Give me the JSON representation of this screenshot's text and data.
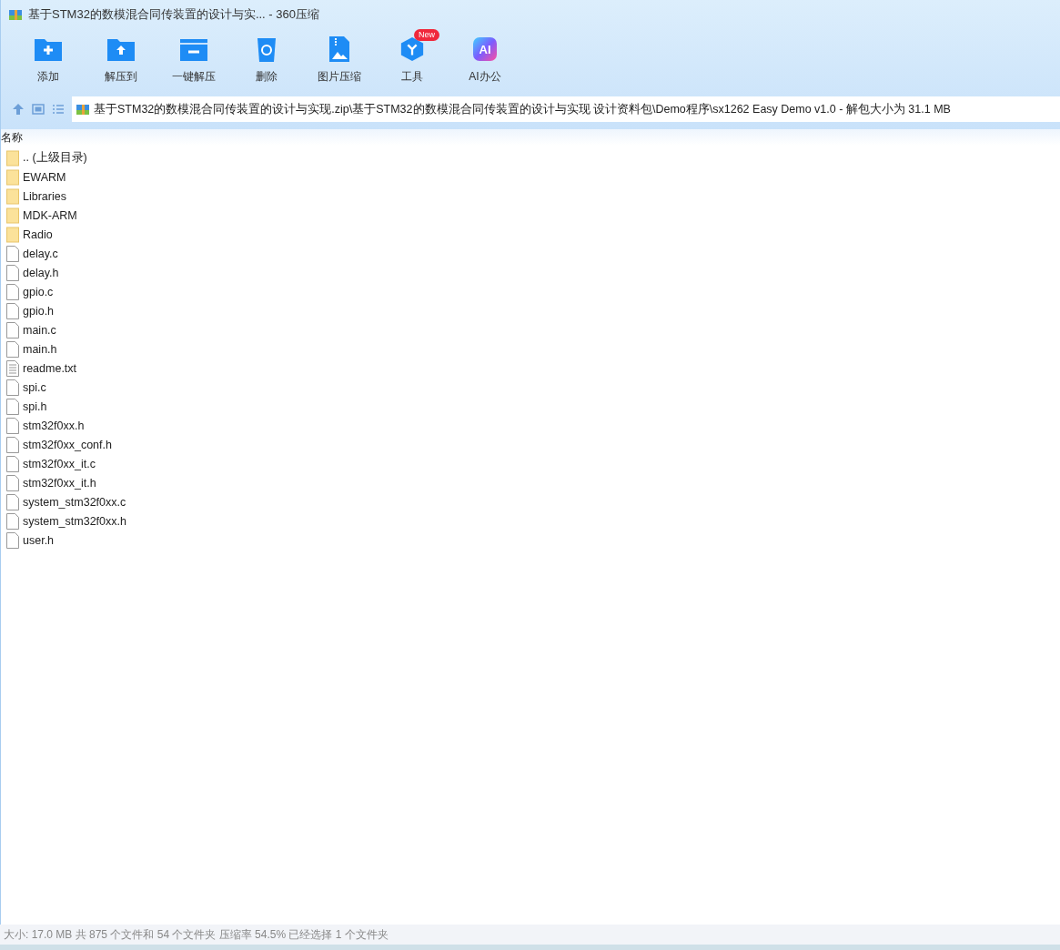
{
  "window": {
    "title": "基于STM32的数模混合同传装置的设计与实... - 360压缩"
  },
  "toolbar": [
    {
      "label": "添加",
      "kind": "add"
    },
    {
      "label": "解压到",
      "kind": "extract"
    },
    {
      "label": "一键解压",
      "kind": "oneclick"
    },
    {
      "label": "删除",
      "kind": "delete"
    },
    {
      "label": "图片压缩",
      "kind": "image"
    },
    {
      "label": "工具",
      "kind": "tools",
      "badge": "New"
    },
    {
      "label": "AI办公",
      "kind": "ai",
      "icon_text": "AI"
    }
  ],
  "address": {
    "path": "基于STM32的数模混合同传装置的设计与实现.zip\\基于STM32的数模混合同传装置的设计与实现 设计资料包\\Demo程序\\sx1262 Easy Demo v1.0 - 解包大小为 31.1 MB"
  },
  "table": {
    "columns": [
      "名称"
    ],
    "rows": [
      {
        "name": ".. (上级目录)",
        "kind": "folder"
      },
      {
        "name": "EWARM",
        "kind": "folder"
      },
      {
        "name": "Libraries",
        "kind": "folder"
      },
      {
        "name": "MDK-ARM",
        "kind": "folder"
      },
      {
        "name": "Radio",
        "kind": "folder"
      },
      {
        "name": "delay.c",
        "kind": "file"
      },
      {
        "name": "delay.h",
        "kind": "file"
      },
      {
        "name": "gpio.c",
        "kind": "file"
      },
      {
        "name": "gpio.h",
        "kind": "file"
      },
      {
        "name": "main.c",
        "kind": "file"
      },
      {
        "name": "main.h",
        "kind": "file"
      },
      {
        "name": "readme.txt",
        "kind": "text"
      },
      {
        "name": "spi.c",
        "kind": "file"
      },
      {
        "name": "spi.h",
        "kind": "file"
      },
      {
        "name": "stm32f0xx.h",
        "kind": "file"
      },
      {
        "name": "stm32f0xx_conf.h",
        "kind": "file"
      },
      {
        "name": "stm32f0xx_it.c",
        "kind": "file"
      },
      {
        "name": "stm32f0xx_it.h",
        "kind": "file"
      },
      {
        "name": "system_stm32f0xx.c",
        "kind": "file"
      },
      {
        "name": "system_stm32f0xx.h",
        "kind": "file"
      },
      {
        "name": "user.h",
        "kind": "file"
      }
    ]
  },
  "status_bar": "大小: 17.0 MB 共 875 个文件和 54 个文件夹 压缩率 54.5% 已经选择 1 个文件夹"
}
